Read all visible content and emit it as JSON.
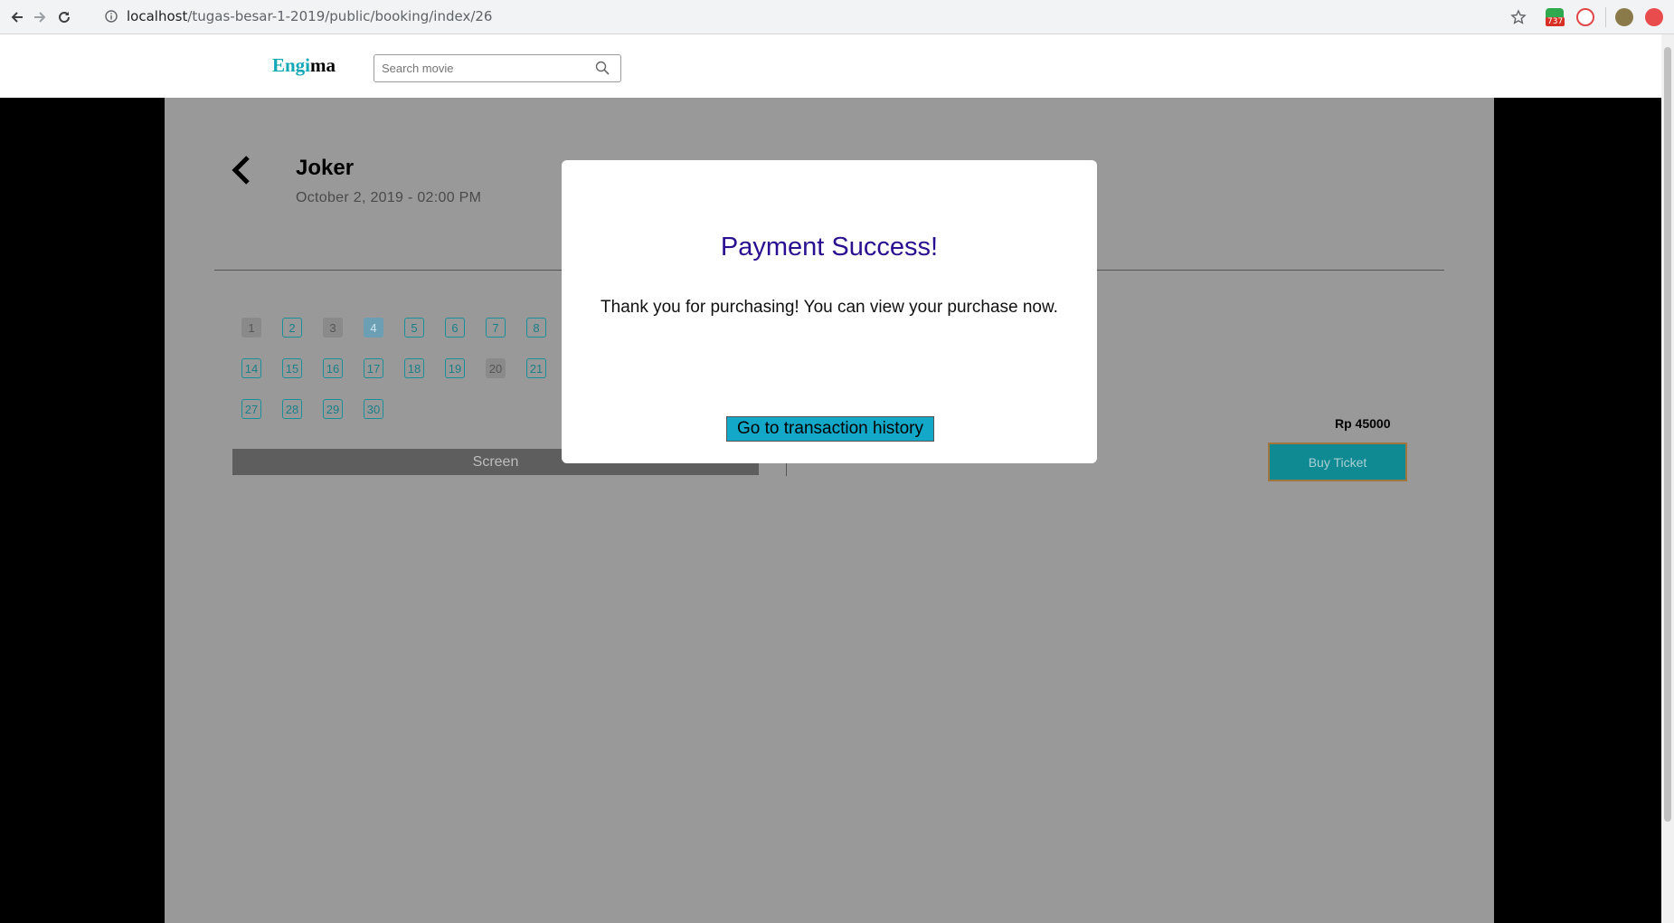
{
  "browser": {
    "url_host": "localhost",
    "url_path": "/tugas-besar-1-2019/public/booking/index/26",
    "badge_count": "737"
  },
  "header": {
    "logo_part1": "Engi",
    "logo_part2": "ma",
    "search_placeholder": "Search movie"
  },
  "movie": {
    "title": "Joker",
    "datetime": "October  2, 2019  -  02:00  PM"
  },
  "seats": {
    "row1": [
      "1",
      "2",
      "3",
      "4",
      "5",
      "6",
      "7",
      "8"
    ],
    "row2": [
      "14",
      "15",
      "16",
      "17",
      "18",
      "19",
      "20",
      "21"
    ],
    "row3": [
      "27",
      "28",
      "29",
      "30"
    ],
    "screen_label": "Screen"
  },
  "summary": {
    "price": "Rp 45000",
    "buy_label": "Buy Ticket"
  },
  "modal": {
    "title": "Payment Success!",
    "message": "Thank you for purchasing! You can view your purchase now.",
    "button_label": "Go to transaction history"
  },
  "colors": {
    "accent": "#12a8b6",
    "modal_title": "#2a1090",
    "modal_button": "#13a8c8"
  }
}
